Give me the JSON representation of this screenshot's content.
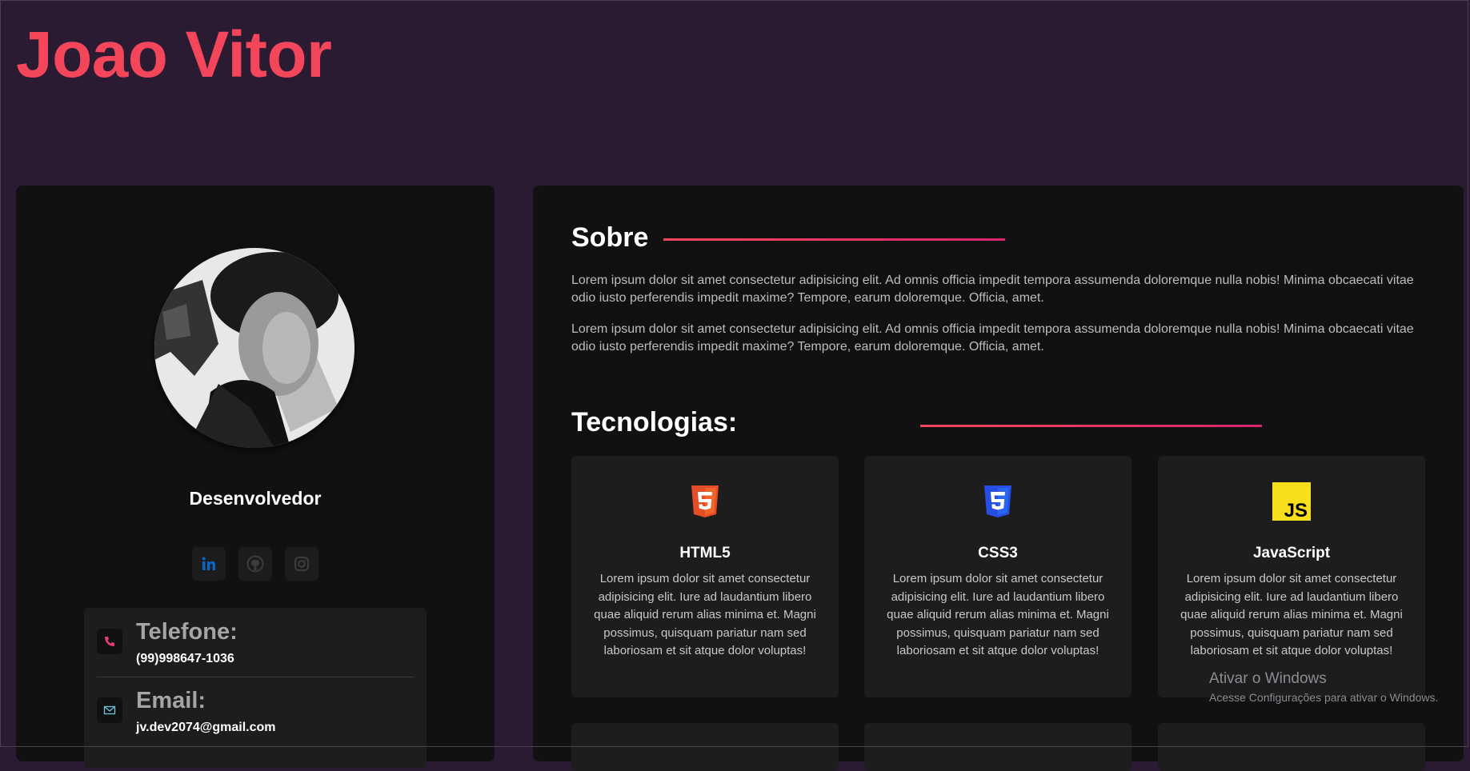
{
  "header": {
    "title": "Joao Vitor"
  },
  "profile": {
    "avatar_alt": "profile photo",
    "role": "Desenvolvedor",
    "socials": [
      {
        "name": "linkedin",
        "icon": "linkedin-icon",
        "color": "#0a66c2"
      },
      {
        "name": "github",
        "icon": "github-icon",
        "color": "#3a3a3a"
      },
      {
        "name": "instagram",
        "icon": "instagram-icon",
        "color": "#3a3a3a"
      }
    ],
    "contacts": [
      {
        "label": "Telefone:",
        "value": "(99)998647-1036",
        "icon": "phone-icon"
      },
      {
        "label": "Email:",
        "value": "jv.dev2074@gmail.com",
        "icon": "mail-icon"
      }
    ]
  },
  "about": {
    "title": "Sobre",
    "paragraphs": [
      "Lorem ipsum dolor sit amet consectetur adipisicing elit. Ad omnis officia impedit tempora assumenda doloremque nulla nobis! Minima obcaecati vitae odio iusto perferendis impedit maxime? Tempore, earum doloremque. Officia, amet.",
      "Lorem ipsum dolor sit amet consectetur adipisicing elit. Ad omnis officia impedit tempora assumenda doloremque nulla nobis! Minima obcaecati vitae odio iusto perferendis impedit maxime? Tempore, earum doloremque. Officia, amet."
    ]
  },
  "tech": {
    "title": "Tecnologias:",
    "items": [
      {
        "name": "HTML5",
        "icon": "html5-icon",
        "color": "#e44d26",
        "desc": "Lorem ipsum dolor sit amet consectetur adipisicing elit. Iure ad laudantium libero quae aliquid rerum alias minima et. Magni possimus, quisquam pariatur nam sed laboriosam et sit atque dolor voluptas!"
      },
      {
        "name": "CSS3",
        "icon": "css3-icon",
        "color": "#264de4",
        "desc": "Lorem ipsum dolor sit amet consectetur adipisicing elit. Iure ad laudantium libero quae aliquid rerum alias minima et. Magni possimus, quisquam pariatur nam sed laboriosam et sit atque dolor voluptas!"
      },
      {
        "name": "JavaScript",
        "icon": "javascript-icon",
        "color": "#f7df1e",
        "desc": "Lorem ipsum dolor sit amet consectetur adipisicing elit. Iure ad laudantium libero quae aliquid rerum alias minima et. Magni possimus, quisquam pariatur nam sed laboriosam et sit atque dolor voluptas!"
      }
    ]
  },
  "colors": {
    "accent": "#f4465a",
    "background": "#2a1b33",
    "card": "#111111",
    "subcard": "#1d1d1d"
  },
  "watermark": {
    "title": "Ativar o Windows",
    "subtitle": "Acesse Configurações para ativar o Windows."
  }
}
